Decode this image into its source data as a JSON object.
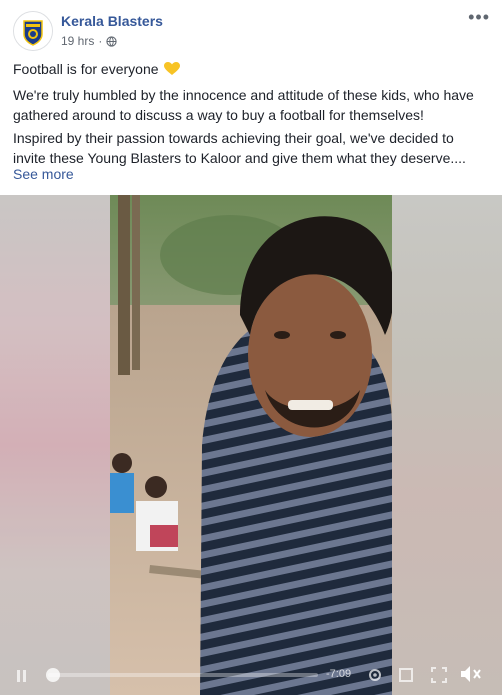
{
  "post": {
    "author": "Kerala Blasters",
    "time": "19 hrs",
    "dot": "·",
    "more": "•••",
    "line1": "Football is for everyone",
    "line2": "We're truly humbled by the innocence and attitude of these kids, who have gathered around to discuss a way to buy a football for themselves!",
    "line3": "Inspired by their passion towards achieving their goal, we've decided to invite these Young Blasters to Kaloor and give them what they deserve....",
    "see_more": "See more"
  },
  "video": {
    "time_remaining": "-7:09",
    "progress": 0.0
  },
  "icons": {
    "logo": "kerala-blasters-logo",
    "privacy": "globe-icon",
    "emoji": "yellow-heart-icon",
    "play": "pause-icon",
    "settings": "gear-icon",
    "fullscreen": "fullscreen-icon",
    "volume": "volume-icon"
  },
  "colors": {
    "link": "#365899",
    "text": "#1d2129",
    "meta": "#606770",
    "heart": "#f7c325"
  }
}
